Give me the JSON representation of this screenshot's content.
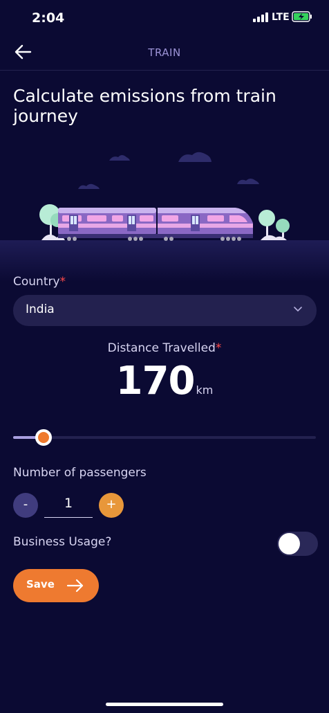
{
  "status_bar": {
    "time": "2:04",
    "network": "LTE"
  },
  "header": {
    "title": "TRAIN",
    "back_icon": "arrow-left-icon"
  },
  "page_title": "Calculate emissions from train journey",
  "form": {
    "country": {
      "label": "Country",
      "required_mark": "*",
      "value": "India",
      "icon": "chevron-down-icon"
    },
    "distance": {
      "label": "Distance Travelled",
      "required_mark": "*",
      "value": "170",
      "unit": "km",
      "slider_fraction": 0.1
    },
    "passengers": {
      "label": "Number of passengers",
      "minus": "-",
      "value": "1",
      "plus": "+"
    },
    "business": {
      "label": "Business Usage?",
      "enabled": false
    },
    "save": {
      "label": "Save",
      "icon": "arrow-right-icon"
    }
  },
  "colors": {
    "background": "#0b0a33",
    "accent": "#ee7a30",
    "field_bg": "#23214f",
    "header_text": "#9c93d6",
    "required": "#ff4a4a"
  }
}
